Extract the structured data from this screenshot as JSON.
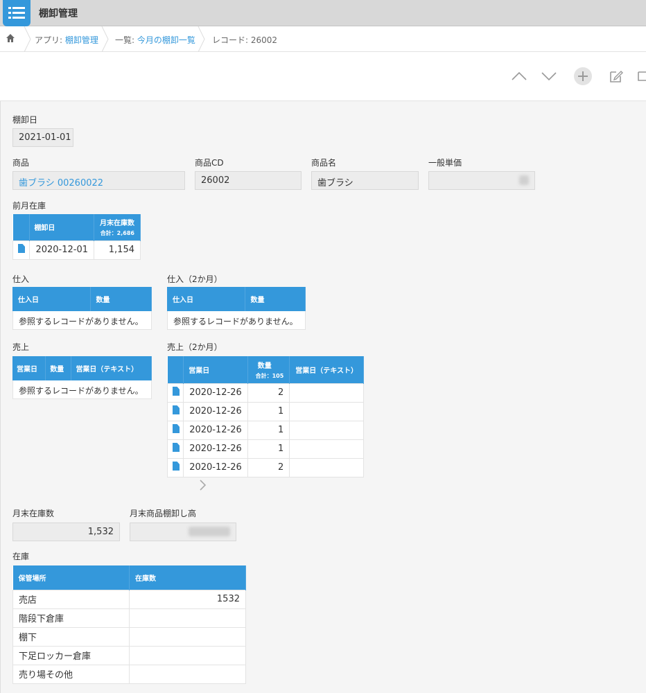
{
  "app": {
    "title": "棚卸管理"
  },
  "breadcrumb": {
    "app_prefix": "アプリ: ",
    "app_name": "棚卸管理",
    "list_prefix": "一覧: ",
    "list_name": "今月の棚卸一覧",
    "record": "レコード: 26002"
  },
  "toolbar": {
    "icons": [
      "home-icon",
      "prev-record-icon",
      "next-record-icon",
      "add-icon",
      "edit-icon",
      "more-icon"
    ]
  },
  "fields": {
    "inventory_date": {
      "label": "棚卸日",
      "value": "2021-01-01"
    },
    "product": {
      "label": "商品",
      "value": "歯ブラシ 00260022"
    },
    "product_cd": {
      "label": "商品CD",
      "value": "26002"
    },
    "product_name": {
      "label": "商品名",
      "value": "歯ブラシ"
    },
    "unit_price": {
      "label": "一般単価",
      "value": ""
    },
    "month_end_stock": {
      "label": "月末在庫数",
      "value": "1,532"
    },
    "month_end_value": {
      "label": "月末商品棚卸し高",
      "value": ""
    }
  },
  "prev_stock": {
    "label": "前月在庫",
    "headers": {
      "date": "棚卸日",
      "count": "月末在庫数",
      "total": "合計：2,686"
    },
    "rows": [
      {
        "date": "2020-12-01",
        "count": "1,154"
      }
    ]
  },
  "purchase": {
    "label": "仕入",
    "headers": {
      "date": "仕入日",
      "qty": "数量"
    },
    "empty": "参照するレコードがありません。"
  },
  "purchase2": {
    "label": "仕入（2か月）",
    "headers": {
      "date": "仕入日",
      "qty": "数量"
    },
    "empty": "参照するレコードがありません。"
  },
  "sales": {
    "label": "売上",
    "headers": {
      "date": "営業日",
      "qty": "数量",
      "date_text": "営業日（テキスト）"
    },
    "empty": "参照するレコードがありません。"
  },
  "sales2": {
    "label": "売上（2か月）",
    "headers": {
      "date": "営業日",
      "qty": "数量",
      "total": "合計：105",
      "date_text": "営業日（テキスト）"
    },
    "rows": [
      {
        "date": "2020-12-26",
        "qty": "2",
        "date_text": ""
      },
      {
        "date": "2020-12-26",
        "qty": "1",
        "date_text": ""
      },
      {
        "date": "2020-12-26",
        "qty": "1",
        "date_text": ""
      },
      {
        "date": "2020-12-26",
        "qty": "1",
        "date_text": ""
      },
      {
        "date": "2020-12-26",
        "qty": "2",
        "date_text": ""
      }
    ]
  },
  "stock": {
    "label": "在庫",
    "headers": {
      "location": "保管場所",
      "count": "在庫数"
    },
    "rows": [
      {
        "location": "売店",
        "count": "1532"
      },
      {
        "location": "階段下倉庫",
        "count": ""
      },
      {
        "location": "棚下",
        "count": ""
      },
      {
        "location": "下足ロッカー倉庫",
        "count": ""
      },
      {
        "location": "売り場その他",
        "count": ""
      }
    ]
  },
  "colors": {
    "accent": "#3498db",
    "topbar": "#d8d8d8",
    "field_bg": "#ececec"
  }
}
